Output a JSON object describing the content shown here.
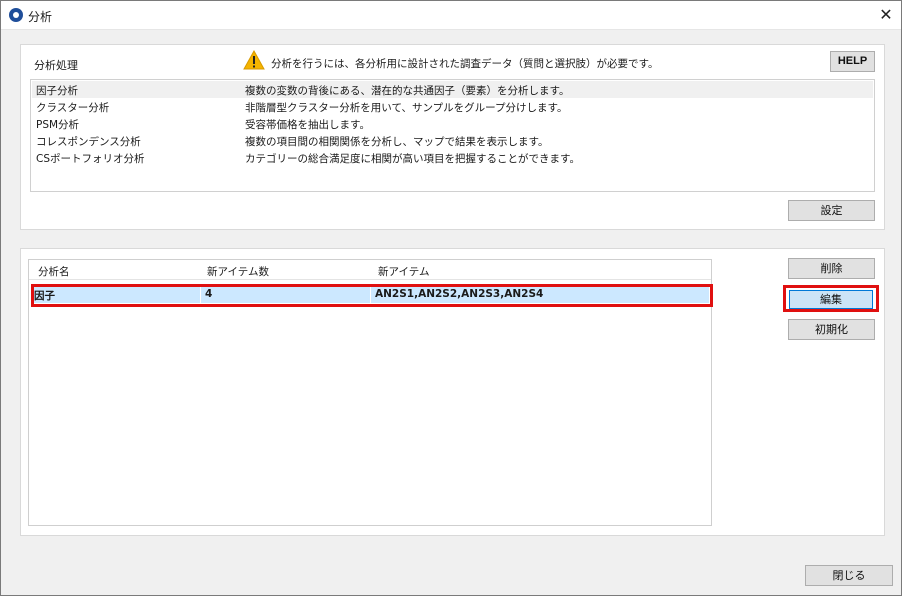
{
  "window": {
    "title": "分析",
    "close_glyph": "✕"
  },
  "analysis_section": {
    "label": "分析処理",
    "warning_text": "分析を行うには、各分析用に設計された調査データ（質問と選択肢）が必要です。",
    "help_label": "HELP",
    "settings_label": "設定",
    "items": [
      {
        "name": "因子分析",
        "desc": "複数の変数の背後にある、潜在的な共通因子（要素）を分析します。",
        "selected": true
      },
      {
        "name": "クラスター分析",
        "desc": "非階層型クラスター分析を用いて、サンプルをグループ分けします。"
      },
      {
        "name": "PSM分析",
        "desc": "受容帯価格を抽出します。"
      },
      {
        "name": "コレスポンデンス分析",
        "desc": "複数の項目間の相関関係を分析し、マップで結果を表示します。"
      },
      {
        "name": "CSポートフォリオ分析",
        "desc": "カテゴリーの総合満足度に相関が高い項目を把握することができます。"
      }
    ]
  },
  "results": {
    "columns": [
      "分析名",
      "新アイテム数",
      "新アイテム"
    ],
    "rows": [
      {
        "name": "因子",
        "count": "4",
        "items": "AN2S1,AN2S2,AN2S3,AN2S4"
      }
    ],
    "delete_label": "削除",
    "edit_label": "編集",
    "reset_label": "初期化"
  },
  "footer": {
    "close_label": "閉じる"
  },
  "colors": {
    "selection": "#cce8ff",
    "highlight": "#e01010",
    "accent": "#1f4e9a"
  }
}
